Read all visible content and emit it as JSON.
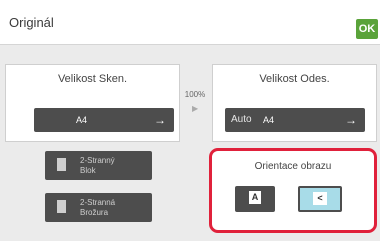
{
  "title": "Originál",
  "ok_label": "OK",
  "scan_size": {
    "label": "Velikost Sken.",
    "value": "A4"
  },
  "zoom": "100%",
  "send_size": {
    "label": "Velikost Odes.",
    "mode": "Auto",
    "value": "A4"
  },
  "duplex_block": {
    "line1": "2-Stranný",
    "line2": "Blok"
  },
  "duplex_booklet": {
    "line1": "2-Stranná",
    "line2": "Brožura"
  },
  "orientation": {
    "title": "Orientace obrazu",
    "portrait_glyph": "A",
    "landscape_glyph": "<",
    "selected": "landscape"
  },
  "colors": {
    "ok": "#5aa33a",
    "highlight": "#e0213b",
    "selected": "#a8dce8"
  }
}
